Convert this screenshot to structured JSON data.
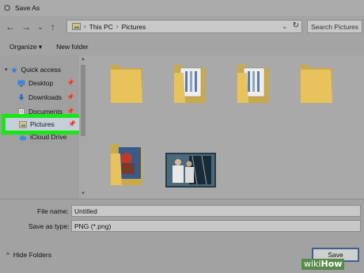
{
  "window": {
    "title": "Save As"
  },
  "nav": {
    "back": "←",
    "forward": "→",
    "recent": "⌄",
    "up": "↑"
  },
  "address": {
    "crumbs": [
      "This PC",
      "Pictures"
    ],
    "separator": "›",
    "dropdown": "⌄",
    "refresh": "↻"
  },
  "search": {
    "placeholder": "Search Pictures"
  },
  "toolbar": {
    "organize": "Organize ▾",
    "new_folder": "New folder"
  },
  "sidebar": {
    "items": [
      {
        "label": "Quick access",
        "icon": "star-icon"
      },
      {
        "label": "Desktop",
        "icon": "desktop-icon",
        "pin": "📌"
      },
      {
        "label": "Downloads",
        "icon": "downloads-icon",
        "pin": "📌"
      },
      {
        "label": "Documents",
        "icon": "documents-icon",
        "pin": "📌"
      },
      {
        "label": "Pictures",
        "icon": "pictures-icon",
        "pin": "📌"
      },
      {
        "label": "iCloud Drive",
        "icon": "icloud-icon"
      }
    ],
    "selected": "Pictures",
    "highlight_color": "#19e619"
  },
  "content": {
    "folders": [
      "folder-empty",
      "folder-with-documents",
      "folder-with-documents",
      "folder-empty",
      "folder-with-photo"
    ],
    "images": [
      "photo-thumbnail"
    ]
  },
  "fields": {
    "file_name_label": "File name:",
    "file_name_value": "Untitled",
    "save_type_label": "Save as type:",
    "save_type_value": "PNG (*.png)"
  },
  "footer": {
    "hide_folders": "Hide Folders",
    "hide_chevron": "^",
    "save": "Save"
  },
  "watermark": {
    "part1": "wiki",
    "part2": "How"
  }
}
